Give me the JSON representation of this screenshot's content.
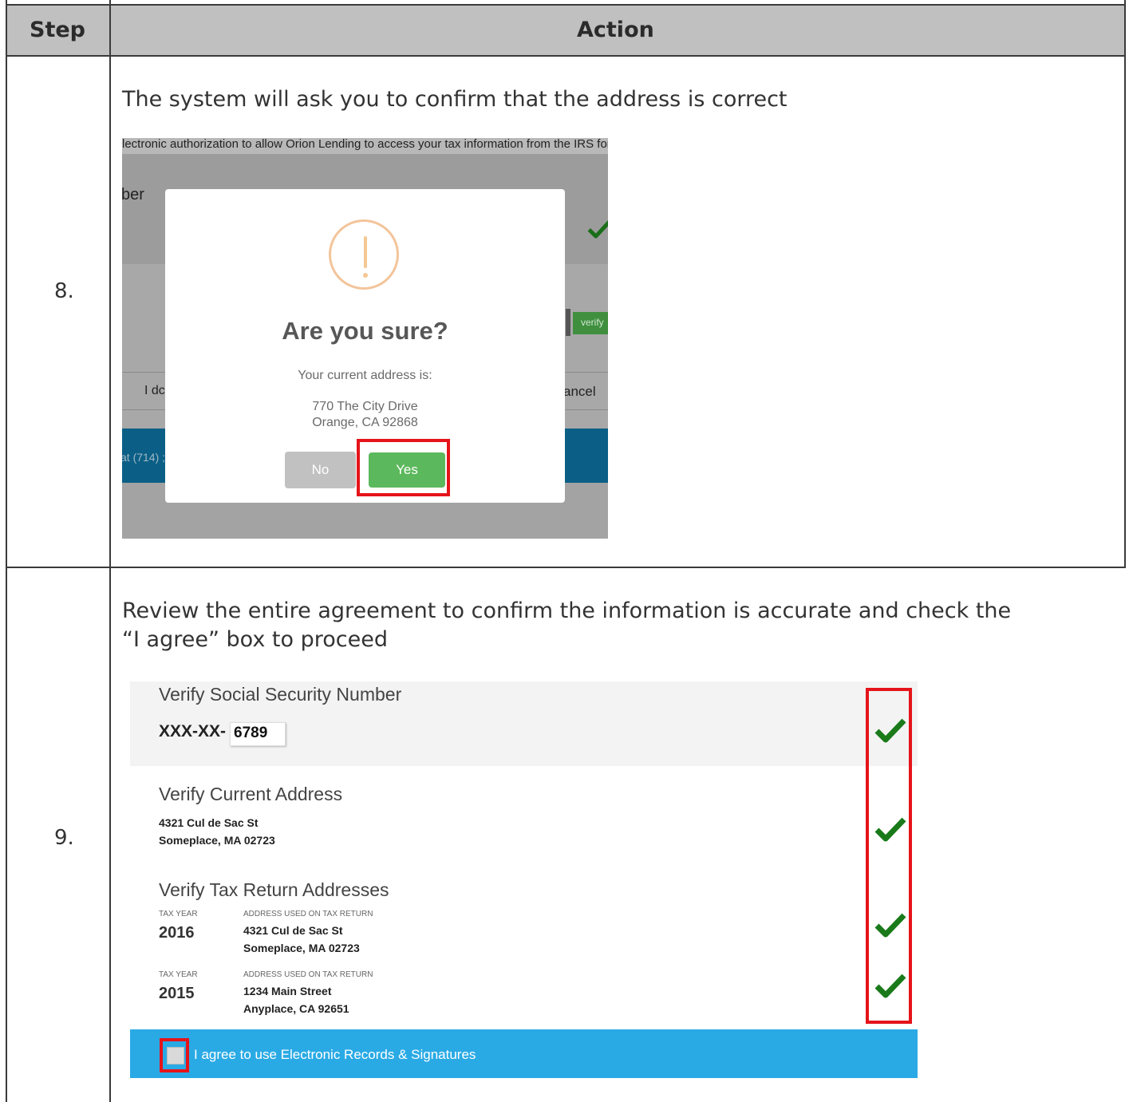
{
  "table": {
    "headers": {
      "step": "Step",
      "action": "Action"
    },
    "rows": [
      {
        "step": "8.",
        "instruction": "The system will ask you to confirm that the address is correct",
        "screenshot": {
          "top_text": "lectronic authorization to allow Orion Lending to access your tax information from the IRS for:",
          "bg_label_1": "ber",
          "bg_label_2": "I dc",
          "bg_label_3": "ancel",
          "bg_label_4": "at (714) ;",
          "verify_button": "verify",
          "modal": {
            "title": "Are you sure?",
            "subtitle": "Your current address is:",
            "address_line1": "770 The City Drive",
            "address_line2": "Orange, CA 92868",
            "no_label": "No",
            "yes_label": "Yes"
          }
        }
      },
      {
        "step": "9.",
        "instruction_line1": "Review the entire agreement to confirm the information is accurate and check the",
        "instruction_line2": "“I agree” box to proceed",
        "screenshot": {
          "ssn_heading": "Verify Social Security Number",
          "ssn_prefix": "XXX-XX-",
          "ssn_value": "6789",
          "address_heading": "Verify Current Address",
          "address_line1": "4321 Cul de Sac St",
          "address_line2": "Someplace, MA 02723",
          "tax_heading": "Verify Tax Return Addresses",
          "tax_returns": [
            {
              "year_label": "TAX YEAR",
              "year": "2016",
              "addr_label": "ADDRESS USED ON TAX RETURN",
              "line1": "4321 Cul de Sac St",
              "line2": "Someplace, MA 02723"
            },
            {
              "year_label": "TAX YEAR",
              "year": "2015",
              "addr_label": "ADDRESS USED ON TAX RETURN",
              "line1": "1234 Main Street",
              "line2": "Anyplace, CA 92651"
            }
          ],
          "agree_label": "I agree to use Electronic Records & Signatures"
        }
      }
    ]
  },
  "colors": {
    "highlight": "#e5141a",
    "check": "#1a7a1a",
    "agree_bar": "#2aaae5",
    "yes_button": "#5cb85c"
  }
}
